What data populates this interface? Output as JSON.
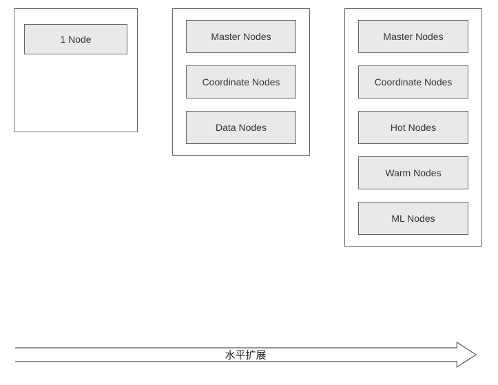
{
  "clusters": [
    {
      "nodes": [
        "1 Node"
      ]
    },
    {
      "nodes": [
        "Master Nodes",
        "Coordinate Nodes",
        "Data Nodes"
      ]
    },
    {
      "nodes": [
        "Master Nodes",
        "Coordinate Nodes",
        "Hot Nodes",
        "Warm Nodes",
        "ML Nodes"
      ]
    }
  ],
  "arrow_label": "水平扩展"
}
